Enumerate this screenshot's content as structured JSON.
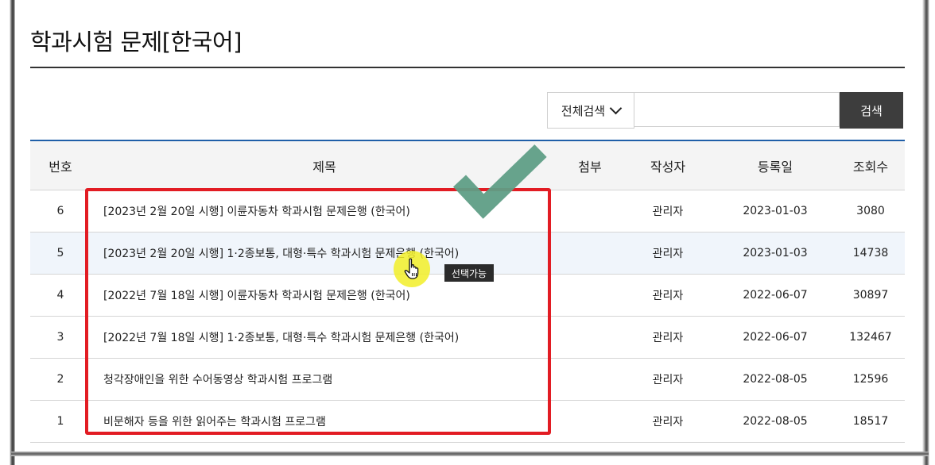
{
  "page": {
    "title": "학과시험 문제[한국어]"
  },
  "search": {
    "scope": "전체검색",
    "query": "",
    "button": "검색"
  },
  "table": {
    "headers": {
      "no": "번호",
      "subject": "제목",
      "attach": "첨부",
      "author": "작성자",
      "date": "등록일",
      "views": "조회수"
    },
    "rows": [
      {
        "no": "6",
        "subject": "[2023년 2월 20일 시행] 이륜자동차 학과시험 문제은행 (한국어)",
        "attach": "",
        "author": "관리자",
        "date": "2023-01-03",
        "views": "3080"
      },
      {
        "no": "5",
        "subject": "[2023년 2월 20일 시행] 1·2종보통, 대형·특수 학과시험 문제은행 (한국어)",
        "attach": "",
        "author": "관리자",
        "date": "2023-01-03",
        "views": "14738"
      },
      {
        "no": "4",
        "subject": "[2022년 7월 18일 시행] 이륜자동차 학과시험 문제은행 (한국어)",
        "attach": "",
        "author": "관리자",
        "date": "2022-06-07",
        "views": "30897"
      },
      {
        "no": "3",
        "subject": "[2022년 7월 18일 시행] 1·2종보통, 대형·특수 학과시험 문제은행 (한국어)",
        "attach": "",
        "author": "관리자",
        "date": "2022-06-07",
        "views": "132467"
      },
      {
        "no": "2",
        "subject": "청각장애인을 위한 수어동영상 학과시험 프로그램",
        "attach": "",
        "author": "관리자",
        "date": "2022-08-05",
        "views": "12596"
      },
      {
        "no": "1",
        "subject": "비문해자 등을 위한 읽어주는 학과시험 프로그램",
        "attach": "",
        "author": "관리자",
        "date": "2022-08-05",
        "views": "18517"
      }
    ]
  },
  "overlay": {
    "tooltip": "선택가능"
  },
  "colors": {
    "table_top_border": "#1f5fa8",
    "highlight_box": "#e21c23",
    "checkmark": "#5f9e86",
    "cursor_halo": "#f2ee28",
    "search_button": "#3d3d3d"
  }
}
